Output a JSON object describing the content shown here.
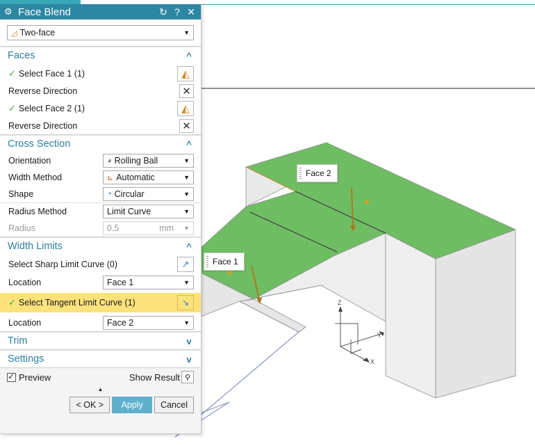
{
  "dialog": {
    "title": "Face Blend",
    "type_dropdown": "Two-face"
  },
  "faces": {
    "title": "Faces",
    "select_face_1": "Select Face 1 (1)",
    "reverse_direction_1": "Reverse Direction",
    "select_face_2": "Select Face 2 (1)",
    "reverse_direction_2": "Reverse Direction"
  },
  "cross_section": {
    "title": "Cross Section",
    "orientation_label": "Orientation",
    "orientation_value": "Rolling Ball",
    "width_method_label": "Width Method",
    "width_method_value": "Automatic",
    "shape_label": "Shape",
    "shape_value": "Circular",
    "radius_method_label": "Radius Method",
    "radius_method_value": "Limit Curve",
    "radius_label": "Radius",
    "radius_value": "0.5",
    "radius_unit": "mm"
  },
  "width_limits": {
    "title": "Width Limits",
    "sharp_limit_label": "Select Sharp Limit Curve (0)",
    "location_label_1": "Location",
    "location_value_1": "Face 1",
    "tangent_limit_label": "Select Tangent Limit Curve (1)",
    "location_label_2": "Location",
    "location_value_2": "Face 2"
  },
  "trim": {
    "title": "Trim"
  },
  "settings": {
    "title": "Settings"
  },
  "footer": {
    "preview_label": "Preview",
    "show_result_label": "Show Result",
    "ok_label": "< OK >",
    "apply_label": "Apply",
    "cancel_label": "Cancel"
  },
  "viewport": {
    "face1_label": "Face 1",
    "face2_label": "Face 2",
    "axis_x": "X",
    "axis_y": "Y",
    "axis_z": "Z"
  },
  "colors": {
    "accent": "#2d87a3",
    "section_title": "#2c7fa0",
    "face_green": "#6fbd63",
    "highlight": "#fbe27b",
    "check": "#38b03a"
  }
}
